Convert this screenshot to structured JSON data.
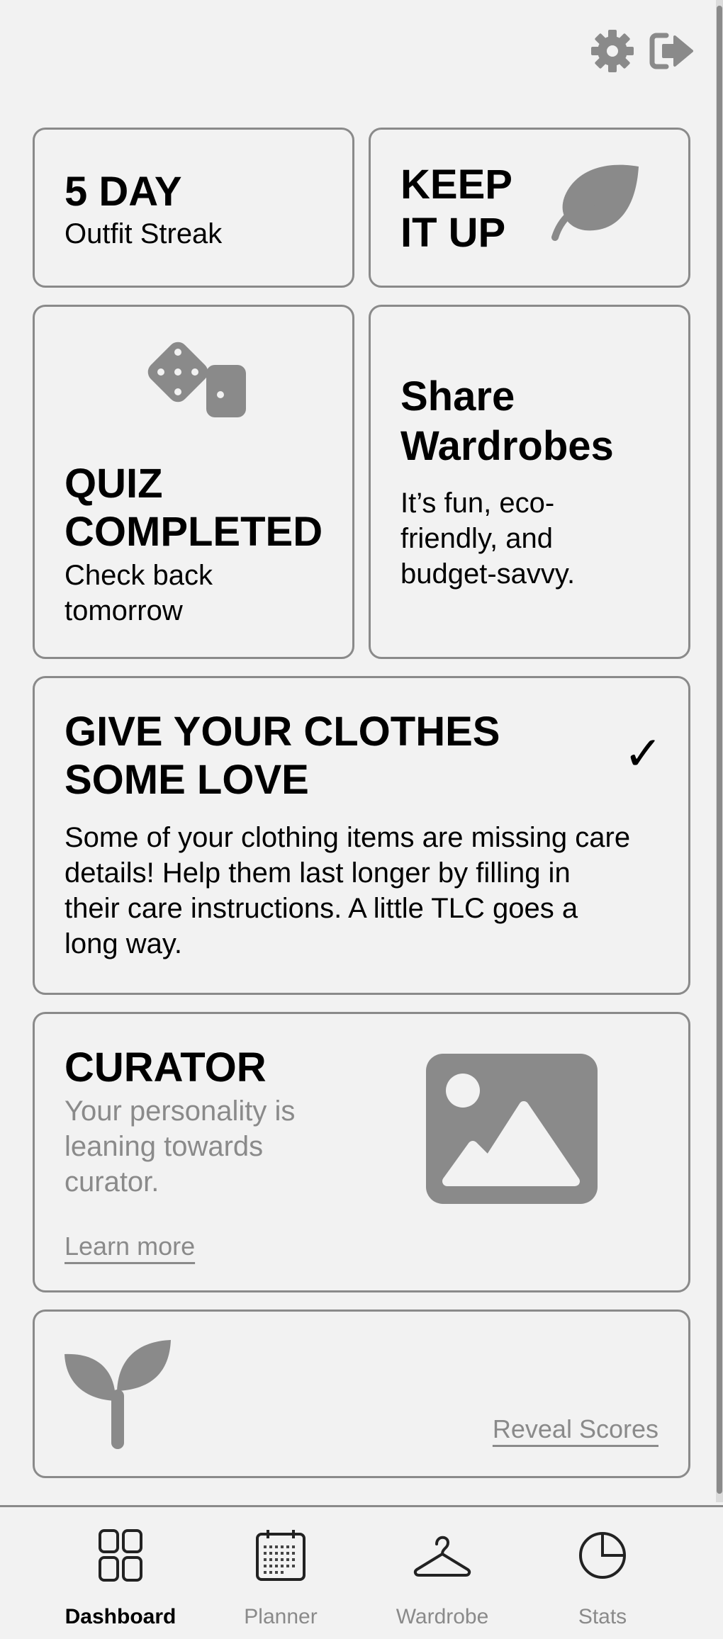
{
  "header": {
    "settings_icon": "gear-icon",
    "logout_icon": "logout-icon"
  },
  "streak": {
    "title": "5 DAY",
    "subtitle": "Outfit Streak"
  },
  "keep": {
    "line1": "KEEP",
    "line2": "IT UP",
    "icon": "leaf-icon"
  },
  "quiz": {
    "line1": "QUIZ",
    "line2": "COMPLETED",
    "sub1": "Check back",
    "sub2": "tomorrow",
    "icon": "dice-icon"
  },
  "share": {
    "line1": "Share",
    "line2": "Wardrobes",
    "body1": "It’s fun, eco-",
    "body2": "friendly, and",
    "body3": "budget-savvy."
  },
  "care": {
    "line1": "GIVE YOUR CLOTHES",
    "line2": "SOME LOVE",
    "check": "✓",
    "body1": "Some of your clothing items are missing care",
    "body2": "details! Help them last longer by filling in",
    "body3": "their care instructions. A little TLC goes a",
    "body4": "long way."
  },
  "curator": {
    "title": "CURATOR",
    "desc1": "Your personality is",
    "desc2": "leaning towards",
    "desc3": "curator.",
    "link": "Learn more",
    "icon": "image-placeholder-icon"
  },
  "scores": {
    "link": "Reveal Scores",
    "icon": "sprout-icon"
  },
  "nav": {
    "items": [
      {
        "label": "Dashboard",
        "icon": "dashboard-icon",
        "active": true
      },
      {
        "label": "Planner",
        "icon": "calendar-icon",
        "active": false
      },
      {
        "label": "Wardrobe",
        "icon": "hanger-icon",
        "active": false
      },
      {
        "label": "Stats",
        "icon": "pie-chart-icon",
        "active": false
      }
    ]
  },
  "colors": {
    "background": "#f2f2f2",
    "border": "#8a8a8a",
    "text": "#000000",
    "muted": "#8a8a8a"
  }
}
